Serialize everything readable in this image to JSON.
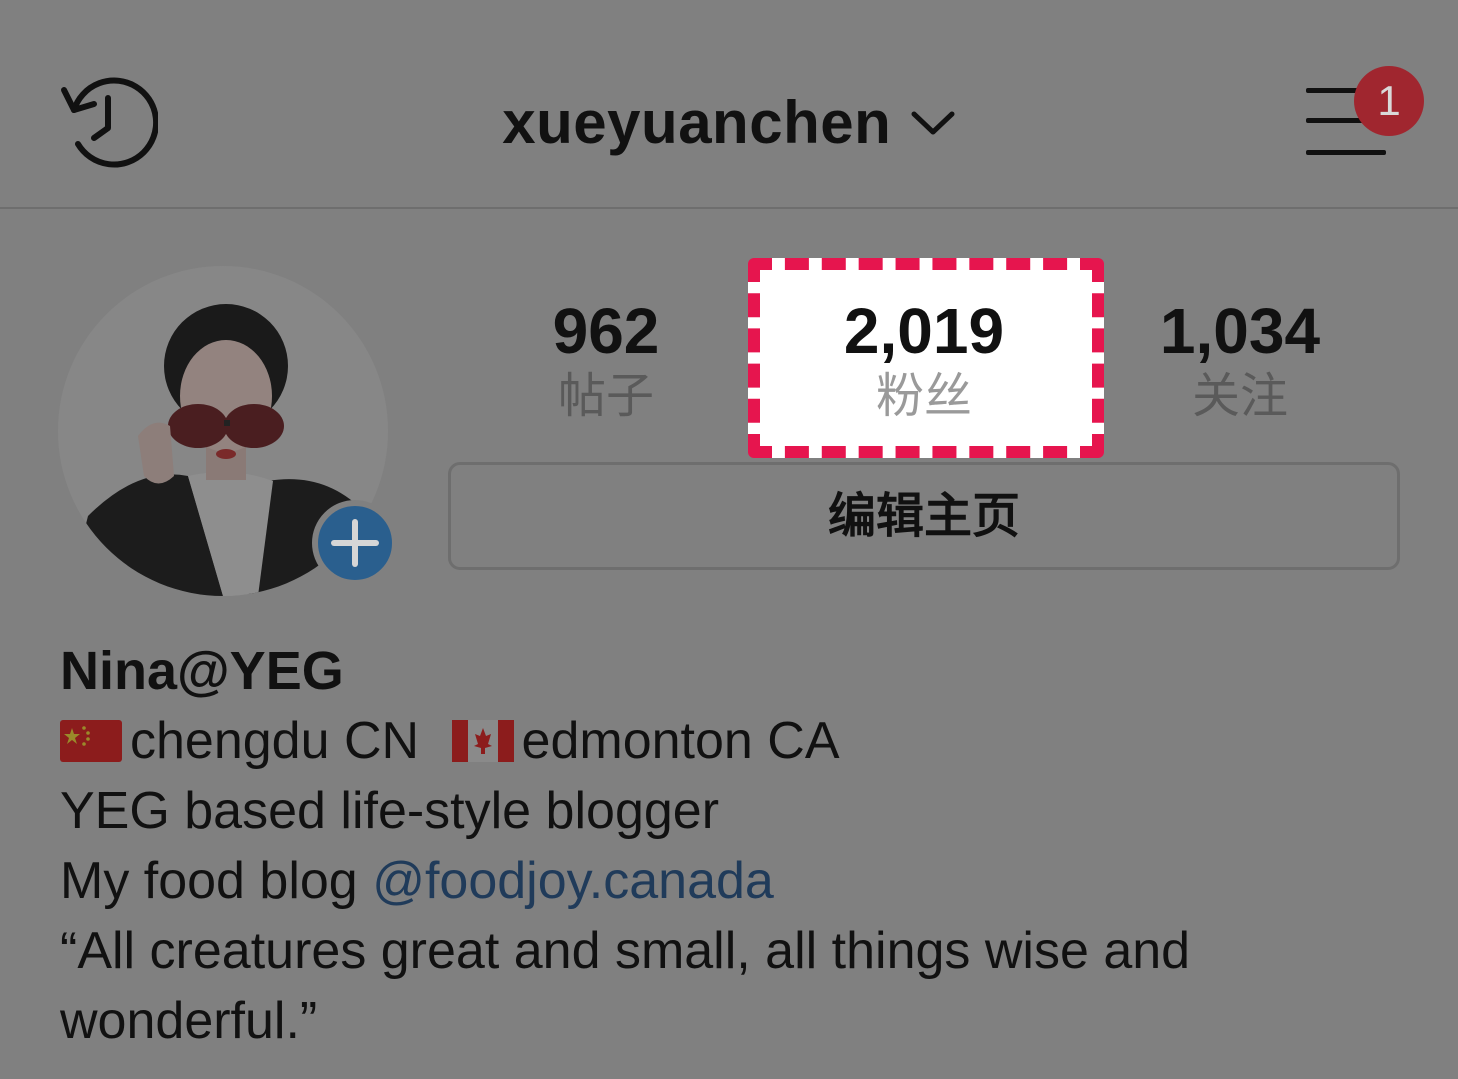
{
  "header": {
    "username": "xueyuanchen",
    "notification_count": "1"
  },
  "icons": {
    "history": "history-icon",
    "dropdown": "chevron-down-icon",
    "menu": "menu-icon",
    "add": "plus-icon"
  },
  "stats": {
    "posts": {
      "value": "962",
      "label": "帖子"
    },
    "followers": {
      "value": "2,019",
      "label": "粉丝"
    },
    "following": {
      "value": "1,034",
      "label": "关注"
    }
  },
  "edit_profile_label": "编辑主页",
  "bio": {
    "name": "Nina@YEG",
    "location_from": "chengdu CN",
    "location_to": "edmonton CA",
    "line2": "YEG based life-style blogger",
    "line3_prefix": "My food blog ",
    "line3_mention": "@foodjoy.canada",
    "quote_line1": "“All creatures great and small, all things wise and",
    "quote_line2": "wonderful.”"
  },
  "colors": {
    "overlay_bg": "#808080",
    "badge": "#a0262f",
    "highlight_border": "#e6154e",
    "add_button": "#2a5f8e",
    "mention": "#203b5a"
  }
}
